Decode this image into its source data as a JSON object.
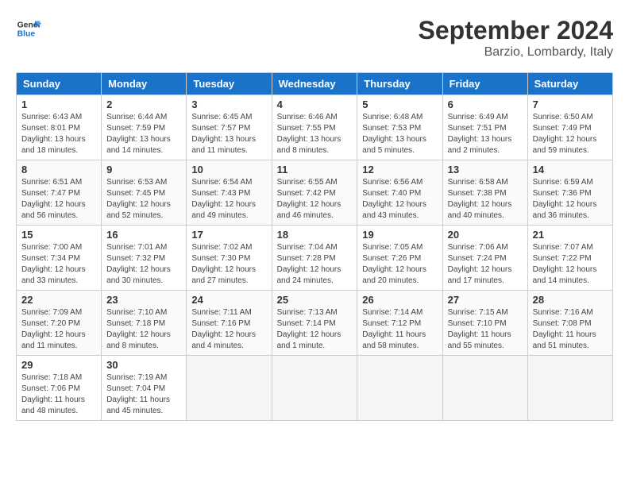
{
  "header": {
    "logo_line1": "General",
    "logo_line2": "Blue",
    "month_title": "September 2024",
    "location": "Barzio, Lombardy, Italy"
  },
  "columns": [
    "Sunday",
    "Monday",
    "Tuesday",
    "Wednesday",
    "Thursday",
    "Friday",
    "Saturday"
  ],
  "weeks": [
    [
      {
        "day": "1",
        "sunrise": "6:43 AM",
        "sunset": "8:01 PM",
        "daylight": "13 hours and 18 minutes."
      },
      {
        "day": "2",
        "sunrise": "6:44 AM",
        "sunset": "7:59 PM",
        "daylight": "13 hours and 14 minutes."
      },
      {
        "day": "3",
        "sunrise": "6:45 AM",
        "sunset": "7:57 PM",
        "daylight": "13 hours and 11 minutes."
      },
      {
        "day": "4",
        "sunrise": "6:46 AM",
        "sunset": "7:55 PM",
        "daylight": "13 hours and 8 minutes."
      },
      {
        "day": "5",
        "sunrise": "6:48 AM",
        "sunset": "7:53 PM",
        "daylight": "13 hours and 5 minutes."
      },
      {
        "day": "6",
        "sunrise": "6:49 AM",
        "sunset": "7:51 PM",
        "daylight": "13 hours and 2 minutes."
      },
      {
        "day": "7",
        "sunrise": "6:50 AM",
        "sunset": "7:49 PM",
        "daylight": "12 hours and 59 minutes."
      }
    ],
    [
      {
        "day": "8",
        "sunrise": "6:51 AM",
        "sunset": "7:47 PM",
        "daylight": "12 hours and 56 minutes."
      },
      {
        "day": "9",
        "sunrise": "6:53 AM",
        "sunset": "7:45 PM",
        "daylight": "12 hours and 52 minutes."
      },
      {
        "day": "10",
        "sunrise": "6:54 AM",
        "sunset": "7:43 PM",
        "daylight": "12 hours and 49 minutes."
      },
      {
        "day": "11",
        "sunrise": "6:55 AM",
        "sunset": "7:42 PM",
        "daylight": "12 hours and 46 minutes."
      },
      {
        "day": "12",
        "sunrise": "6:56 AM",
        "sunset": "7:40 PM",
        "daylight": "12 hours and 43 minutes."
      },
      {
        "day": "13",
        "sunrise": "6:58 AM",
        "sunset": "7:38 PM",
        "daylight": "12 hours and 40 minutes."
      },
      {
        "day": "14",
        "sunrise": "6:59 AM",
        "sunset": "7:36 PM",
        "daylight": "12 hours and 36 minutes."
      }
    ],
    [
      {
        "day": "15",
        "sunrise": "7:00 AM",
        "sunset": "7:34 PM",
        "daylight": "12 hours and 33 minutes."
      },
      {
        "day": "16",
        "sunrise": "7:01 AM",
        "sunset": "7:32 PM",
        "daylight": "12 hours and 30 minutes."
      },
      {
        "day": "17",
        "sunrise": "7:02 AM",
        "sunset": "7:30 PM",
        "daylight": "12 hours and 27 minutes."
      },
      {
        "day": "18",
        "sunrise": "7:04 AM",
        "sunset": "7:28 PM",
        "daylight": "12 hours and 24 minutes."
      },
      {
        "day": "19",
        "sunrise": "7:05 AM",
        "sunset": "7:26 PM",
        "daylight": "12 hours and 20 minutes."
      },
      {
        "day": "20",
        "sunrise": "7:06 AM",
        "sunset": "7:24 PM",
        "daylight": "12 hours and 17 minutes."
      },
      {
        "day": "21",
        "sunrise": "7:07 AM",
        "sunset": "7:22 PM",
        "daylight": "12 hours and 14 minutes."
      }
    ],
    [
      {
        "day": "22",
        "sunrise": "7:09 AM",
        "sunset": "7:20 PM",
        "daylight": "12 hours and 11 minutes."
      },
      {
        "day": "23",
        "sunrise": "7:10 AM",
        "sunset": "7:18 PM",
        "daylight": "12 hours and 8 minutes."
      },
      {
        "day": "24",
        "sunrise": "7:11 AM",
        "sunset": "7:16 PM",
        "daylight": "12 hours and 4 minutes."
      },
      {
        "day": "25",
        "sunrise": "7:13 AM",
        "sunset": "7:14 PM",
        "daylight": "12 hours and 1 minute."
      },
      {
        "day": "26",
        "sunrise": "7:14 AM",
        "sunset": "7:12 PM",
        "daylight": "11 hours and 58 minutes."
      },
      {
        "day": "27",
        "sunrise": "7:15 AM",
        "sunset": "7:10 PM",
        "daylight": "11 hours and 55 minutes."
      },
      {
        "day": "28",
        "sunrise": "7:16 AM",
        "sunset": "7:08 PM",
        "daylight": "11 hours and 51 minutes."
      }
    ],
    [
      {
        "day": "29",
        "sunrise": "7:18 AM",
        "sunset": "7:06 PM",
        "daylight": "11 hours and 48 minutes."
      },
      {
        "day": "30",
        "sunrise": "7:19 AM",
        "sunset": "7:04 PM",
        "daylight": "11 hours and 45 minutes."
      },
      null,
      null,
      null,
      null,
      null
    ]
  ]
}
